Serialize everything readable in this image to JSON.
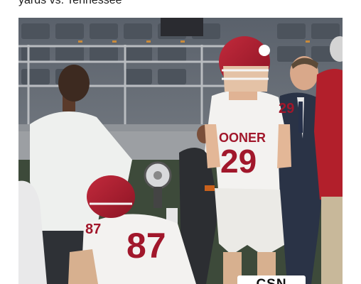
{
  "post": {
    "caption": "yards vs. Tennessee"
  },
  "photo": {
    "jersey_numbers": {
      "kicker": "29",
      "holder": "87"
    },
    "uniform_text": "OONER",
    "watermark_text": "CSN"
  },
  "colors": {
    "crimson": "#a1172b",
    "jersey_white": "#f3f2f0",
    "stadium_seat": "#5b636d",
    "turf": "#3d4a3a"
  }
}
